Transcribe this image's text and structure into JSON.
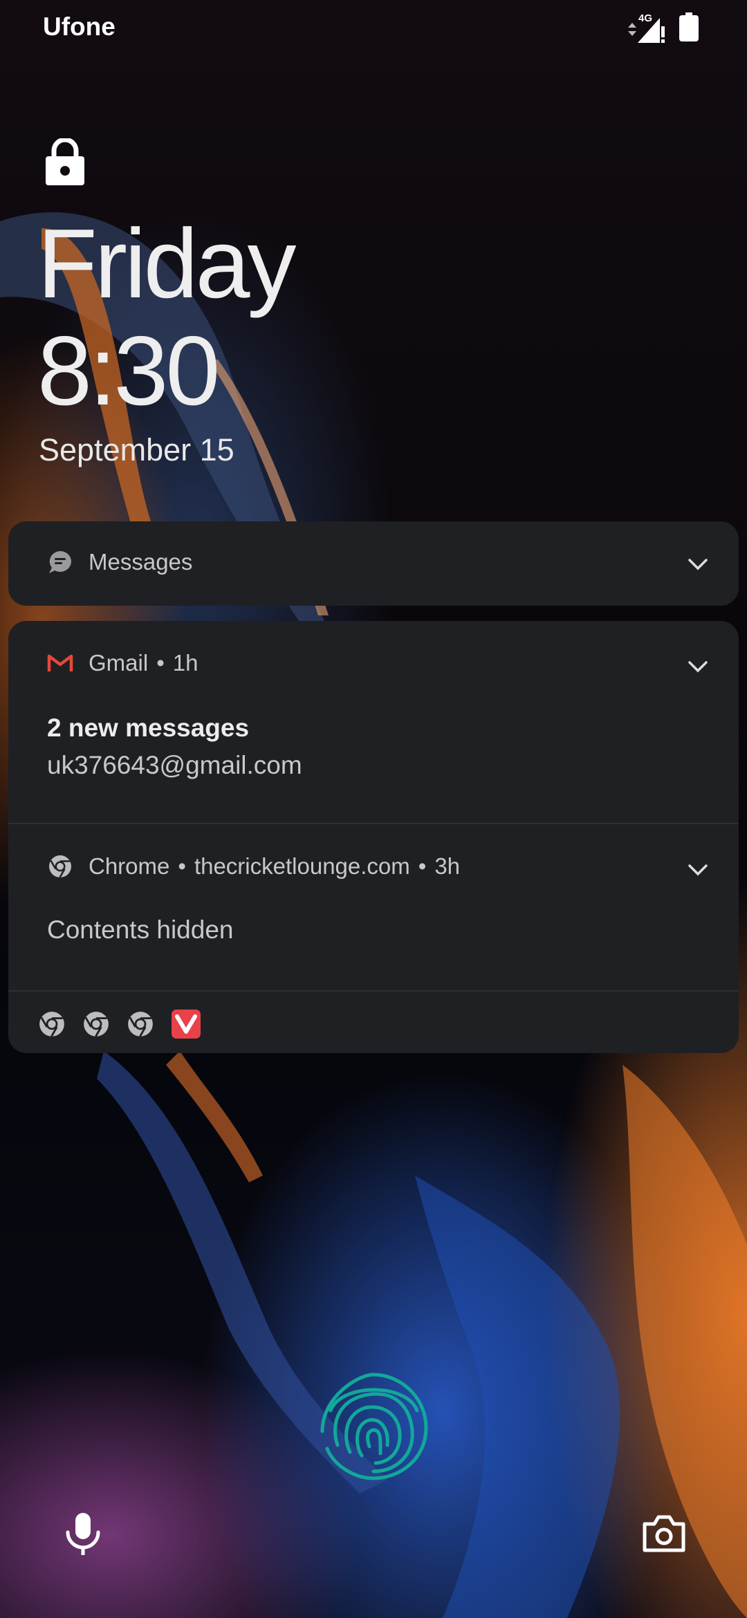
{
  "status_bar": {
    "carrier": "Ufone",
    "network": "4G",
    "battery_icon": "battery-icon",
    "signal_icon": "signal-icon"
  },
  "lockscreen": {
    "day": "Friday",
    "time": "8:30",
    "date": "September 15",
    "lock_icon": "lock-icon"
  },
  "notifications": {
    "messages": {
      "app": "Messages",
      "icon": "messages-icon"
    },
    "gmail": {
      "app": "Gmail",
      "age": "1h",
      "title": "2 new messages",
      "account": "uk376643@gmail.com",
      "icon": "gmail-icon",
      "accent": "#e5483b"
    },
    "chrome": {
      "app": "Chrome",
      "site": "thecricketlounge.com",
      "age": "3h",
      "body": "Contents hidden",
      "icon": "chrome-icon"
    },
    "overflow_icons": [
      "chrome-icon",
      "chrome-icon",
      "chrome-icon",
      "vivaldi-icon"
    ],
    "vivaldi_color": "#e8414a"
  },
  "bottom": {
    "fingerprint_icon": "fingerprint-icon",
    "fingerprint_color": "#12a89a",
    "mic_icon": "mic-icon",
    "camera_icon": "camera-icon"
  }
}
